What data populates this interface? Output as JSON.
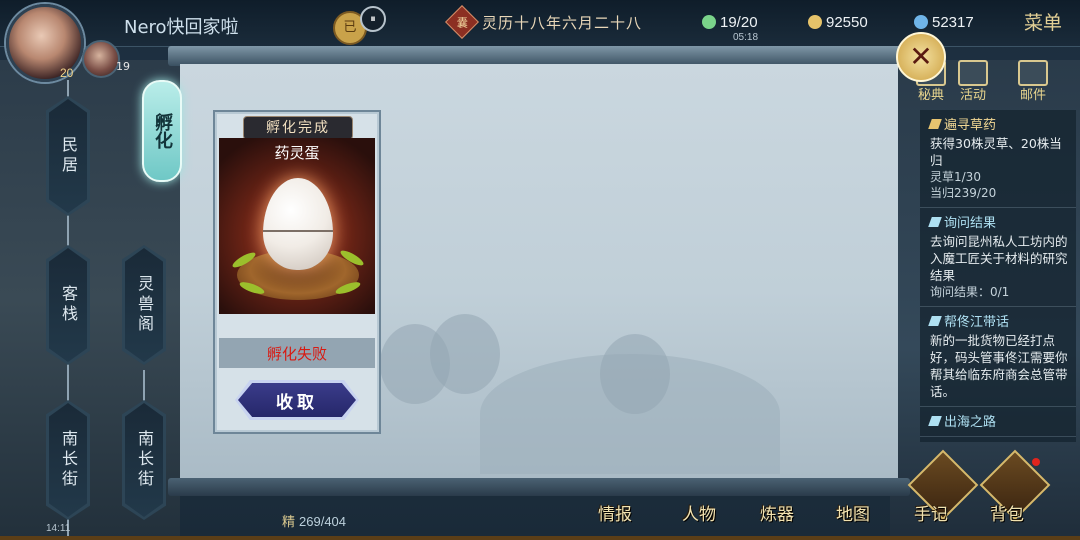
{
  "header": {
    "player_name": "Nero快回家啦",
    "player_level": "20",
    "companion_level": "19",
    "date_tag": "已",
    "pause_icon": "⏸",
    "calendar_badge": "囊",
    "calendar_text": "灵历十八年六月二十八",
    "resources": [
      {
        "icon": "energy-icon",
        "value": "19/20",
        "color": "#7ad38a"
      },
      {
        "icon": "coin-icon",
        "value": "92550",
        "color": "#e6c36a"
      },
      {
        "icon": "spirit-stone-icon",
        "value": "52317",
        "color": "#6fb4e8"
      }
    ],
    "clock": "05:18",
    "menu_label": "菜单"
  },
  "map": {
    "locations": [
      "民居",
      "客栈",
      "灵兽阁",
      "南长街",
      "南长街"
    ],
    "hatch_tab": "孵化"
  },
  "card": {
    "title": "孵化完成",
    "egg_name": "药灵蛋",
    "status": "孵化失败",
    "collect_label": "收取"
  },
  "close_icon": "✕",
  "shortcuts": [
    "秘典",
    "活动",
    "邮件"
  ],
  "quests": [
    {
      "title": "遍寻草药",
      "body": "获得30株灵草、20株当归",
      "progress": [
        "灵草1/30",
        "当归239/20"
      ]
    },
    {
      "title": "询问结果",
      "body": "去询问昆州私人工坊内的入魔工匠关于材料的研究结果",
      "progress": [
        "询问结果：0/1"
      ]
    },
    {
      "title": "帮佟江带话",
      "body": "新的一批货物已经打点好，码头管事佟江需要你帮其给临东府商会总管带话。",
      "progress": []
    },
    {
      "title": "出海之路",
      "body": "",
      "progress": []
    }
  ],
  "bottom": {
    "stamina_label": "精",
    "stamina_value": "269/404",
    "system_time": "14:11",
    "nav": [
      "情报",
      "人物",
      "炼器",
      "地图",
      "手记",
      "背包"
    ]
  }
}
